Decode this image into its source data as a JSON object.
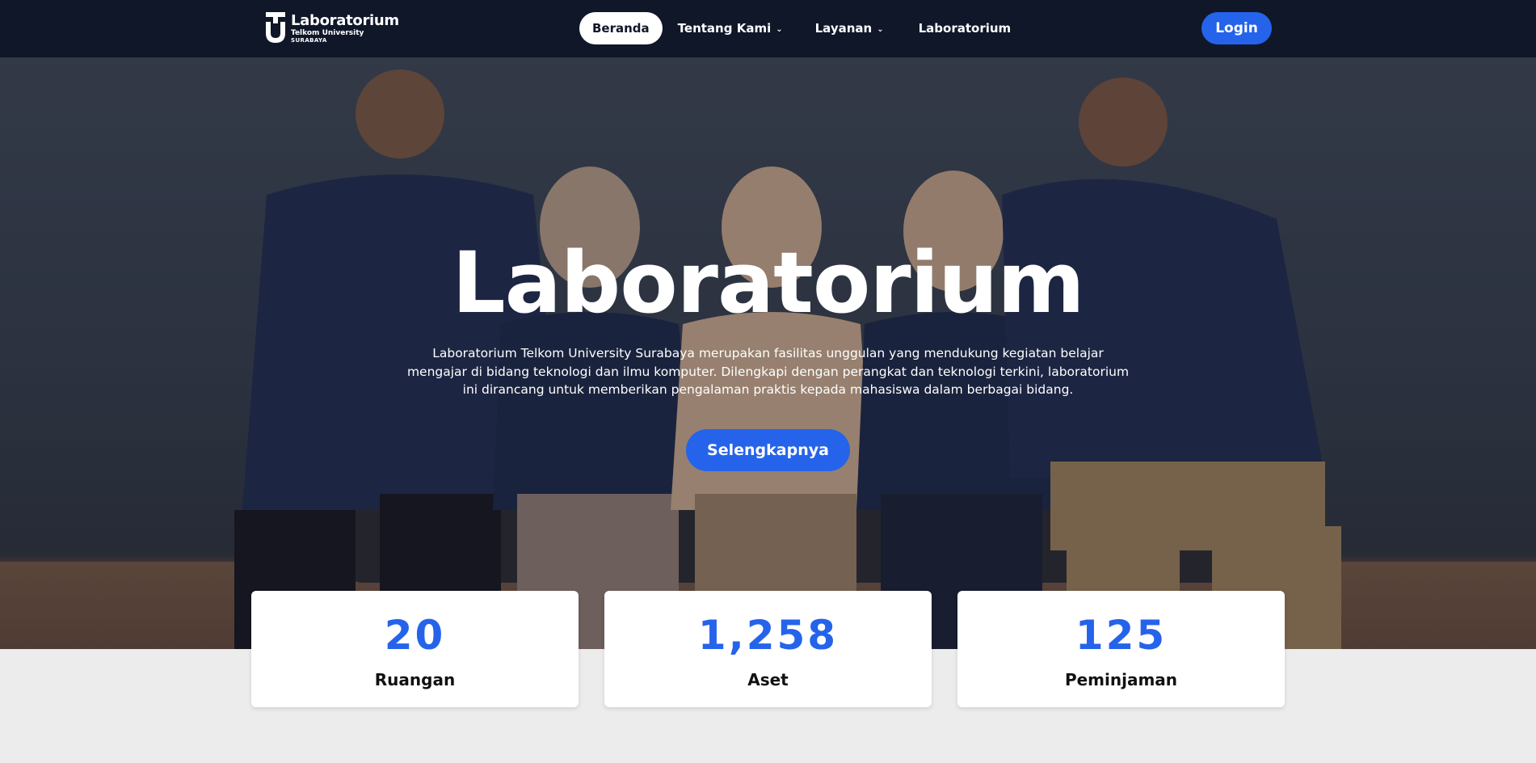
{
  "navbar": {
    "logo": {
      "title": "Laboratorium",
      "subtitle": "Telkom University",
      "location": "SURABAYA"
    },
    "menu": [
      {
        "label": "Beranda",
        "active": true,
        "has_dropdown": false
      },
      {
        "label": "Tentang Kami",
        "active": false,
        "has_dropdown": true
      },
      {
        "label": "Layanan",
        "active": false,
        "has_dropdown": true
      },
      {
        "label": "Laboratorium",
        "active": false,
        "has_dropdown": false
      }
    ],
    "login_label": "Login"
  },
  "hero": {
    "title": "Laboratorium",
    "description": "Laboratorium Telkom University Surabaya merupakan fasilitas unggulan yang mendukung kegiatan belajar mengajar di bidang teknologi dan ilmu komputer. Dilengkapi dengan perangkat dan teknologi terkini, laboratorium ini dirancang untuk memberikan pengalaman praktis kepada mahasiswa dalam berbagai bidang.",
    "cta_label": "Selengkapnya"
  },
  "stats": [
    {
      "value": "20",
      "label": "Ruangan"
    },
    {
      "value": "1,258",
      "label": "Aset"
    },
    {
      "value": "125",
      "label": "Peminjaman"
    }
  ],
  "colors": {
    "navbar_bg": "#0f1729",
    "accent": "#2563eb",
    "page_bg": "#ececec"
  },
  "icons": {
    "logo": "telkom-university-logo-icon",
    "dropdown": "chevron-down-icon"
  }
}
